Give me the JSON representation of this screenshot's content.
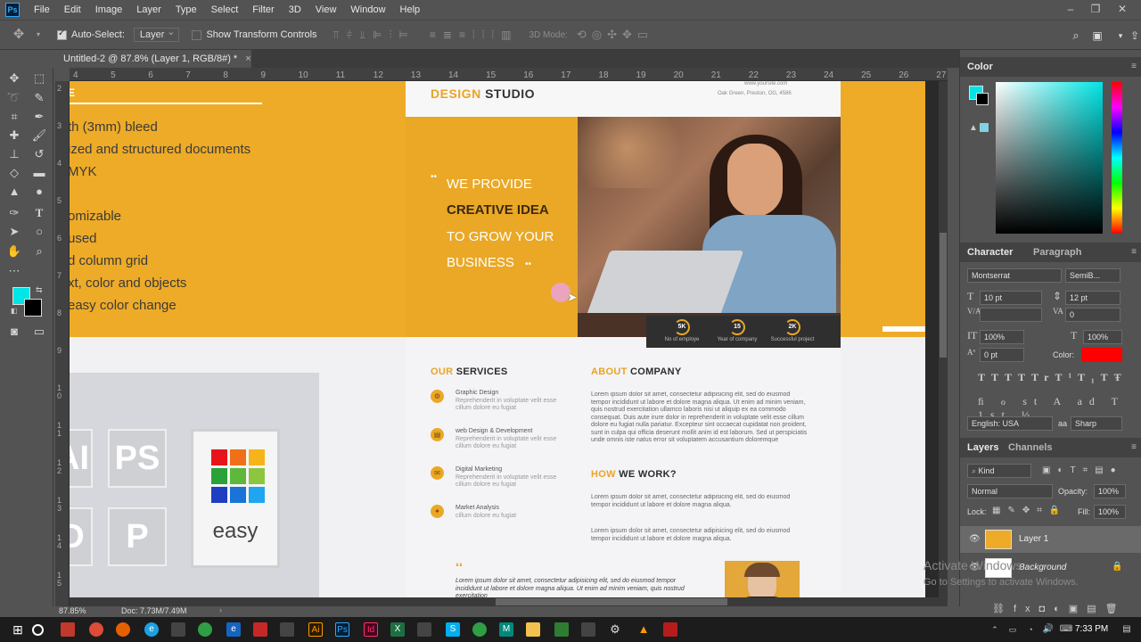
{
  "menubar": {
    "app_icon": "Ps",
    "items": [
      "File",
      "Edit",
      "Image",
      "Layer",
      "Type",
      "Select",
      "Filter",
      "3D",
      "View",
      "Window",
      "Help"
    ],
    "window_controls": [
      "minimize-icon",
      "restore-icon",
      "close-icon"
    ]
  },
  "options": {
    "auto_select_label": "Auto-Select:",
    "auto_select_value": "Layer",
    "transform_label": "Show Transform Controls",
    "mode_label": "3D Mode:"
  },
  "document": {
    "tab_title": "Untitled-2 @ 87.8% (Layer 1, RGB/8#) *",
    "close": "×",
    "ruler_h": [
      "4",
      "5",
      "6",
      "7",
      "8",
      "9",
      "10",
      "11",
      "12",
      "13",
      "14",
      "15",
      "16",
      "17",
      "18",
      "19",
      "20",
      "21",
      "22",
      "23",
      "24",
      "25",
      "26",
      "27"
    ],
    "ruler_v": [
      "2",
      "3",
      "4",
      "5",
      "6",
      "7",
      "8",
      "9",
      "1 0",
      "1 1",
      "1 2",
      "1 3",
      "1 4",
      "1 5",
      "1 6"
    ]
  },
  "canvas": {
    "left_lines": [
      "th (3mm) bleed",
      "ized and structured documents",
      "MYK",
      "omizable",
      "used",
      "d column grid",
      "xt, color and objects",
      "easy color change"
    ],
    "cards": {
      "ai": "AI",
      "ps": "PS",
      "d": "D",
      "p": "P",
      "easy": "easy"
    },
    "flyer": {
      "brand_accent": "DESIGN",
      "brand_rest": "STUDIO",
      "address_top": "www.yoursite.com",
      "address": "Oak Green, Preston, OG, 4586",
      "tagline_1": "WE PROVIDE",
      "tagline_2": "CREATIVE IDEA",
      "tagline_3": "TO GROW YOUR",
      "tagline_4": "BUSINESS",
      "stats": [
        {
          "value": "5K",
          "caption": "No of employe"
        },
        {
          "value": "15",
          "caption": "Year of company"
        },
        {
          "value": "2K",
          "caption": "Successful project"
        }
      ],
      "services_accent": "OUR",
      "services_rest": "SERVICES",
      "services": [
        {
          "title": "Graphic Design",
          "desc": "Reprehenderit in voluptate velit esse cillum dolore eu fugiat"
        },
        {
          "title": "web Design & Development",
          "desc": "Reprehenderit in voluptate velit esse cillum dolore eu fugiat"
        },
        {
          "title": "Digital Marketing",
          "desc": "Reprehenderit in voluptate velit esse cillum dolore eu fugiat"
        },
        {
          "title": "Market Analysis",
          "desc": "cillum dolore eu fugiat"
        }
      ],
      "about_accent": "ABOUT",
      "about_rest": "COMPANY",
      "about_text": "Lorem ipsum dolor sit amet, consectetur adipisicing elit, sed do eiusmod tempor incididunt ut labore et dolore magna aliqua. Ut enim ad minim veniam, quis nostrud exercitation ullamco laboris nisi ut aliquip ex ea commodo consequat. Duis aute irure dolor in reprehenderit in voluptate velit esse cillum dolore eu fugiat nulla pariatur. Excepteur sint occaecat cupidatat non proident, sunt in culpa qui officia deserunt mollit anim id est laborum. Sed ut perspiciatis unde omnis iste natus error sit voluptatem accusantium doloremque laudantium, totam rem aperiam, eaque ipsa quae ab illo inventore veritatis et quasi architecto beatae vitae dicta sunt explicabo.",
      "how_accent": "HOW",
      "how_rest": "WE WORK?",
      "how_text_1": "Lorem ipsum dolor sit amet, consectetur adipisicing elit, sed do eiusmod tempor incididunt ut labore et dolore magna aliqua.",
      "how_text_2": "Lorem ipsum dolor sit amet, consectetur adipisicing elit, sed do eiusmod tempor incididunt ut labore et dolore magna aliqua.",
      "quote_mark": "❛❛",
      "quote": "Lorem ipsum dolor sit amet, consectetur adipisicing elit, sed do eiusmod tempor incididunt ut labore et dolore magna aliqua. Ut enim ad minim veniam, quis nostrud exercitation"
    }
  },
  "panels": {
    "color_tab": "Color",
    "fg_color": "#00e5e5",
    "character_tab": "Character",
    "paragraph_tab": "Paragraph",
    "font_family": "Montserrat",
    "font_style": "SemiB...",
    "font_size": "10 pt",
    "leading": "12 pt",
    "tracking": "0",
    "vscale": "100%",
    "hscale": "100%",
    "baseline": "0 pt",
    "color_label": "Color:",
    "text_color": "#ff0000",
    "language": "English: USA",
    "antialias_icon": "aa",
    "antialias": "Sharp",
    "layers_tab": "Layers",
    "channels_tab": "Channels",
    "kind": "Kind",
    "blend": "Normal",
    "opacity_label": "Opacity:",
    "opacity": "100%",
    "lock_label": "Lock:",
    "fill_label": "Fill:",
    "fill": "100%",
    "layers": [
      {
        "name": "Layer 1"
      },
      {
        "name": "Background"
      }
    ]
  },
  "status": {
    "zoom": "87.85%",
    "doc": "Doc: 7.73M/7.49M"
  },
  "watermark": {
    "line1": "Activate Windows",
    "line2": "Go to Settings to activate Windows."
  },
  "taskbar": {
    "time": "7:33 PM"
  }
}
